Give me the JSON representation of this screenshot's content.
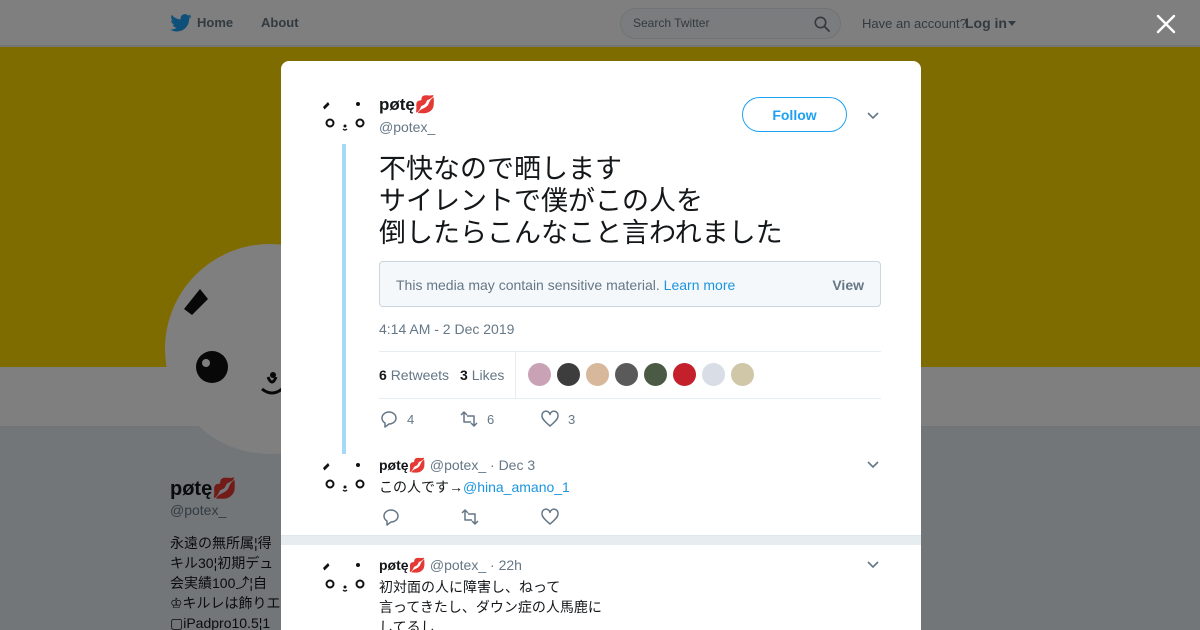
{
  "topbar": {
    "home_label": "Home",
    "about_label": "About",
    "search_placeholder": "Search Twitter",
    "have_account": "Have an account?",
    "login_label": "Log in"
  },
  "profile": {
    "name": "pøtę💋",
    "handle": "@potex_",
    "bio": "永遠の無所属¦得\nキル30¦初期デュ\n会実績100⤴︎¦自\n♔キルレは飾りエ\n▢iPadpro10.5¦1",
    "banner_color": "#ffd900"
  },
  "colors": {
    "accent": "#1da1f2",
    "link": "#1b95e0",
    "thread_line": "#a4d9f9",
    "muted": "#657786"
  },
  "tweet": {
    "name": "pøtę💋",
    "handle": "@potex_",
    "follow_label": "Follow",
    "text": "不快なので晒します\nサイレントで僕がこの人を\n倒したらこんなこと言われました",
    "sensitive_msg": "This media may contain sensitive material.",
    "learn_more": "Learn more",
    "view_label": "View",
    "timestamp": "4:14 AM - 2 Dec 2019",
    "retweets_count": "6",
    "retweets_label": "Retweets",
    "likes_count": "3",
    "likes_label": "Likes",
    "reply_count": "4",
    "retweet_count": "6",
    "like_count": "3"
  },
  "replies": [
    {
      "name": "pøtę💋",
      "meta": "@potex_ · Dec 3",
      "text": "この人です→",
      "mention": "@hina_amano_1"
    },
    {
      "name": "pøtę💋",
      "meta": "@potex_ · 22h",
      "text": "初対面の人に障害し、ねって\n言ってきたし、ダウン症の人馬鹿に\nしてるし"
    }
  ],
  "icons": {
    "logo": "twitter-bird-icon",
    "search": "search-icon",
    "close": "close-icon",
    "caret": "caret-down-icon",
    "reply": "reply-icon",
    "retweet": "retweet-icon",
    "like": "heart-icon",
    "more": "chevron-down-icon"
  }
}
